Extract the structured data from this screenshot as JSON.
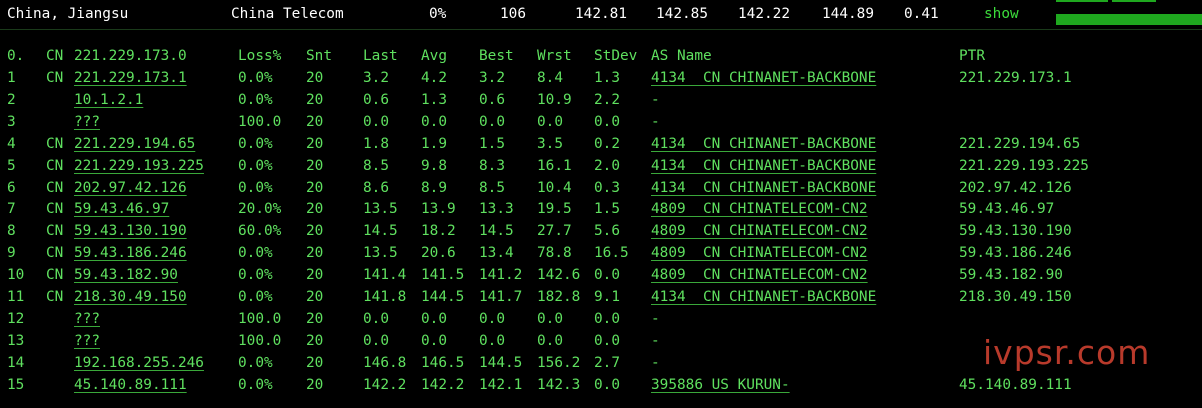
{
  "summary": {
    "location": "China, Jiangsu",
    "isp": "China Telecom",
    "loss": "0%",
    "sent": "106",
    "last": "142.81",
    "avg": "142.85",
    "best": "142.22",
    "worst": "144.89",
    "stdev": "0.41",
    "show_label": "show"
  },
  "table": {
    "header": {
      "idx": "0.",
      "cc": "CN",
      "host": "221.229.173.0",
      "loss": "Loss%",
      "snt": "Snt",
      "last": "Last",
      "avg": "Avg",
      "best": "Best",
      "wrst": "Wrst",
      "stdev": "StDev",
      "as": "AS Name",
      "ptr": "PTR"
    },
    "rows": [
      {
        "idx": "1",
        "cc": "CN",
        "host": "221.229.173.1",
        "loss": "0.0%",
        "snt": "20",
        "last": "3.2",
        "avg": "4.2",
        "best": "3.2",
        "wrst": "8.4",
        "stdev": "1.3",
        "as": "4134  CN CHINANET-BACKBONE",
        "ptr": "221.229.173.1"
      },
      {
        "idx": "2",
        "cc": "",
        "host": "10.1.2.1",
        "loss": "0.0%",
        "snt": "20",
        "last": "0.6",
        "avg": "1.3",
        "best": "0.6",
        "wrst": "10.9",
        "stdev": "2.2",
        "as": "-",
        "ptr": ""
      },
      {
        "idx": "3",
        "cc": "",
        "host": "???",
        "loss": "100.0",
        "snt": "20",
        "last": "0.0",
        "avg": "0.0",
        "best": "0.0",
        "wrst": "0.0",
        "stdev": "0.0",
        "as": "-",
        "ptr": ""
      },
      {
        "idx": "4",
        "cc": "CN",
        "host": "221.229.194.65",
        "loss": "0.0%",
        "snt": "20",
        "last": "1.8",
        "avg": "1.9",
        "best": "1.5",
        "wrst": "3.5",
        "stdev": "0.2",
        "as": "4134  CN CHINANET-BACKBONE",
        "ptr": "221.229.194.65"
      },
      {
        "idx": "5",
        "cc": "CN",
        "host": "221.229.193.225",
        "loss": "0.0%",
        "snt": "20",
        "last": "8.5",
        "avg": "9.8",
        "best": "8.3",
        "wrst": "16.1",
        "stdev": "2.0",
        "as": "4134  CN CHINANET-BACKBONE",
        "ptr": "221.229.193.225"
      },
      {
        "idx": "6",
        "cc": "CN",
        "host": "202.97.42.126",
        "loss": "0.0%",
        "snt": "20",
        "last": "8.6",
        "avg": "8.9",
        "best": "8.5",
        "wrst": "10.4",
        "stdev": "0.3",
        "as": "4134  CN CHINANET-BACKBONE",
        "ptr": "202.97.42.126"
      },
      {
        "idx": "7",
        "cc": "CN",
        "host": "59.43.46.97",
        "loss": "20.0%",
        "snt": "20",
        "last": "13.5",
        "avg": "13.9",
        "best": "13.3",
        "wrst": "19.5",
        "stdev": "1.5",
        "as": "4809  CN CHINATELECOM-CN2",
        "ptr": "59.43.46.97"
      },
      {
        "idx": "8",
        "cc": "CN",
        "host": "59.43.130.190",
        "loss": "60.0%",
        "snt": "20",
        "last": "14.5",
        "avg": "18.2",
        "best": "14.5",
        "wrst": "27.7",
        "stdev": "5.6",
        "as": "4809  CN CHINATELECOM-CN2",
        "ptr": "59.43.130.190"
      },
      {
        "idx": "9",
        "cc": "CN",
        "host": "59.43.186.246",
        "loss": "0.0%",
        "snt": "20",
        "last": "13.5",
        "avg": "20.6",
        "best": "13.4",
        "wrst": "78.8",
        "stdev": "16.5",
        "as": "4809  CN CHINATELECOM-CN2",
        "ptr": "59.43.186.246"
      },
      {
        "idx": "10",
        "cc": "CN",
        "host": "59.43.182.90",
        "loss": "0.0%",
        "snt": "20",
        "last": "141.4",
        "avg": "141.5",
        "best": "141.2",
        "wrst": "142.6",
        "stdev": "0.0",
        "as": "4809  CN CHINATELECOM-CN2",
        "ptr": "59.43.182.90"
      },
      {
        "idx": "11",
        "cc": "CN",
        "host": "218.30.49.150",
        "loss": "0.0%",
        "snt": "20",
        "last": "141.8",
        "avg": "144.5",
        "best": "141.7",
        "wrst": "182.8",
        "stdev": "9.1",
        "as": "4134  CN CHINANET-BACKBONE",
        "ptr": "218.30.49.150"
      },
      {
        "idx": "12",
        "cc": "",
        "host": "???",
        "loss": "100.0",
        "snt": "20",
        "last": "0.0",
        "avg": "0.0",
        "best": "0.0",
        "wrst": "0.0",
        "stdev": "0.0",
        "as": "-",
        "ptr": ""
      },
      {
        "idx": "13",
        "cc": "",
        "host": "???",
        "loss": "100.0",
        "snt": "20",
        "last": "0.0",
        "avg": "0.0",
        "best": "0.0",
        "wrst": "0.0",
        "stdev": "0.0",
        "as": "-",
        "ptr": ""
      },
      {
        "idx": "14",
        "cc": "",
        "host": "192.168.255.246",
        "loss": "0.0%",
        "snt": "20",
        "last": "146.8",
        "avg": "146.5",
        "best": "144.5",
        "wrst": "156.2",
        "stdev": "2.7",
        "as": "-",
        "ptr": ""
      },
      {
        "idx": "15",
        "cc": "",
        "host": "45.140.89.111",
        "loss": "0.0%",
        "snt": "20",
        "last": "142.2",
        "avg": "142.2",
        "best": "142.1",
        "wrst": "142.3",
        "stdev": "0.0",
        "as": "395886 US KURUN-",
        "ptr": "45.140.89.111"
      }
    ]
  },
  "watermark": "ivpsr.com",
  "colors": {
    "terminal_text": "#5fe05f",
    "header_text": "#ffffff",
    "bar_fill": "#1fa81f",
    "watermark": "#b83a2b"
  }
}
